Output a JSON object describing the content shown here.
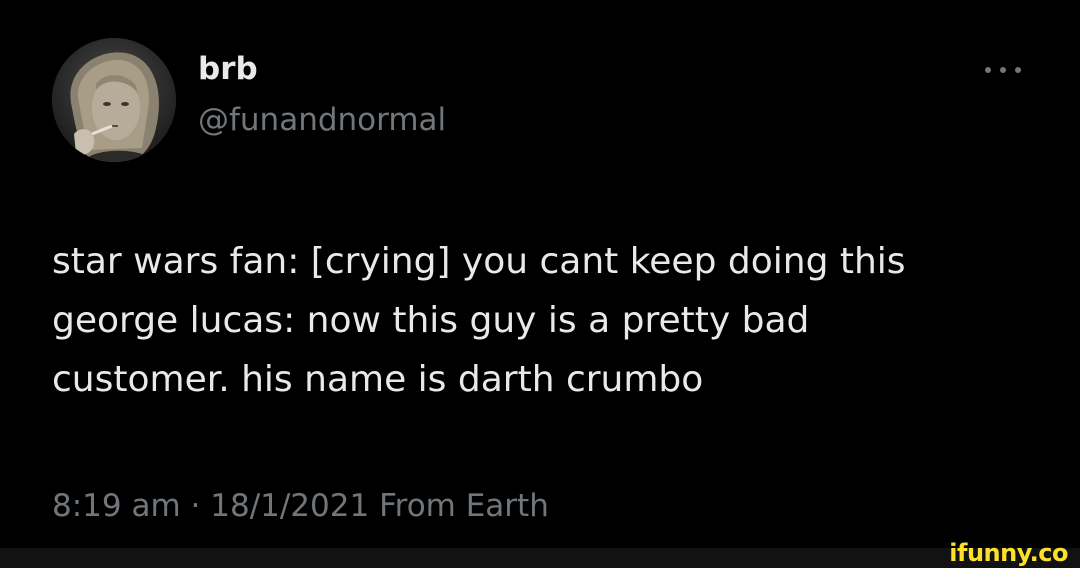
{
  "tweet": {
    "author": {
      "display_name": "brb",
      "handle": "@funandnormal",
      "avatar_icon": "profile-photo"
    },
    "more_icon": "ellipsis-icon",
    "text_lines": [
      "star wars fan: [crying] you cant keep doing this",
      "george lucas: now this guy is a pretty bad",
      "customer. his name is darth crumbo"
    ],
    "time": "8:19 am",
    "separator": "·",
    "date": "18/1/2021",
    "source": "From Earth"
  },
  "watermark": {
    "text": "ifunny.co"
  },
  "colors": {
    "background": "#000000",
    "primary_text": "#e7e9ea",
    "secondary_text": "#71767b",
    "watermark": "#fbe12c",
    "footer_bar": "#121212"
  }
}
